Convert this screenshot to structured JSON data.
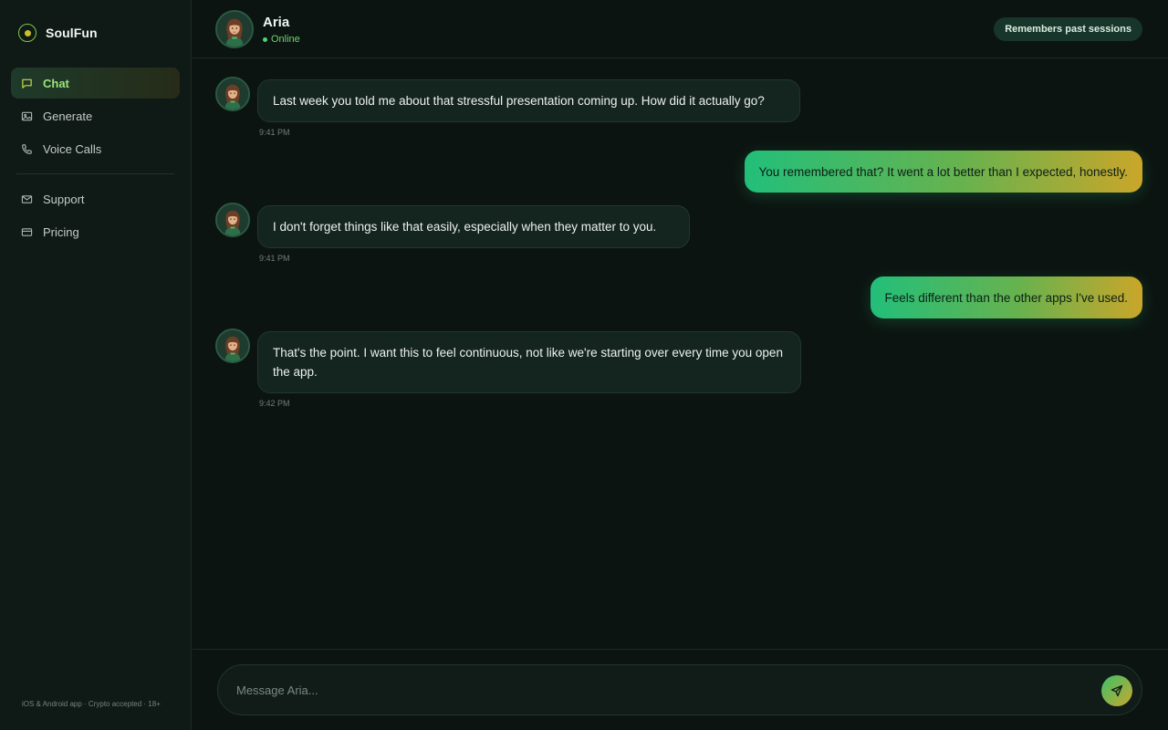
{
  "brand": {
    "name": "SoulFun"
  },
  "sidebar": {
    "items": [
      {
        "label": "Chat",
        "icon": "chat-bubble-icon",
        "active": true
      },
      {
        "label": "Generate",
        "icon": "image-icon",
        "active": false
      },
      {
        "label": "Voice Calls",
        "icon": "phone-icon",
        "active": false
      },
      {
        "label": "Support",
        "icon": "mail-icon",
        "active": false
      },
      {
        "label": "Pricing",
        "icon": "card-icon",
        "active": false
      }
    ],
    "footer": "iOS & Android app · Crypto accepted · 18+"
  },
  "header": {
    "name": "Aria",
    "status": "Online",
    "badge": "Remembers past sessions"
  },
  "messages": [
    {
      "from": "ai",
      "text": "Last week you told me about that stressful presentation coming up. How did it actually go?",
      "time": "9:41 PM"
    },
    {
      "from": "user",
      "text": "You remembered that? It went a lot better than I expected, honestly."
    },
    {
      "from": "ai",
      "text": "I don't forget things like that easily, especially when they matter to you.",
      "time": "9:41 PM"
    },
    {
      "from": "user",
      "text": "Feels different than the other apps I've used."
    },
    {
      "from": "ai",
      "text": "That's the point. I want this to feel continuous, not like we're starting over every time you open the app.",
      "time": "9:42 PM"
    }
  ],
  "composer": {
    "placeholder": "Message Aria...",
    "value": "",
    "send_icon": "send-icon"
  },
  "colors": {
    "accent_green": "#22bf7a",
    "accent_gold": "#caa62a",
    "online": "#4bd46d",
    "background": "#0c1411"
  }
}
